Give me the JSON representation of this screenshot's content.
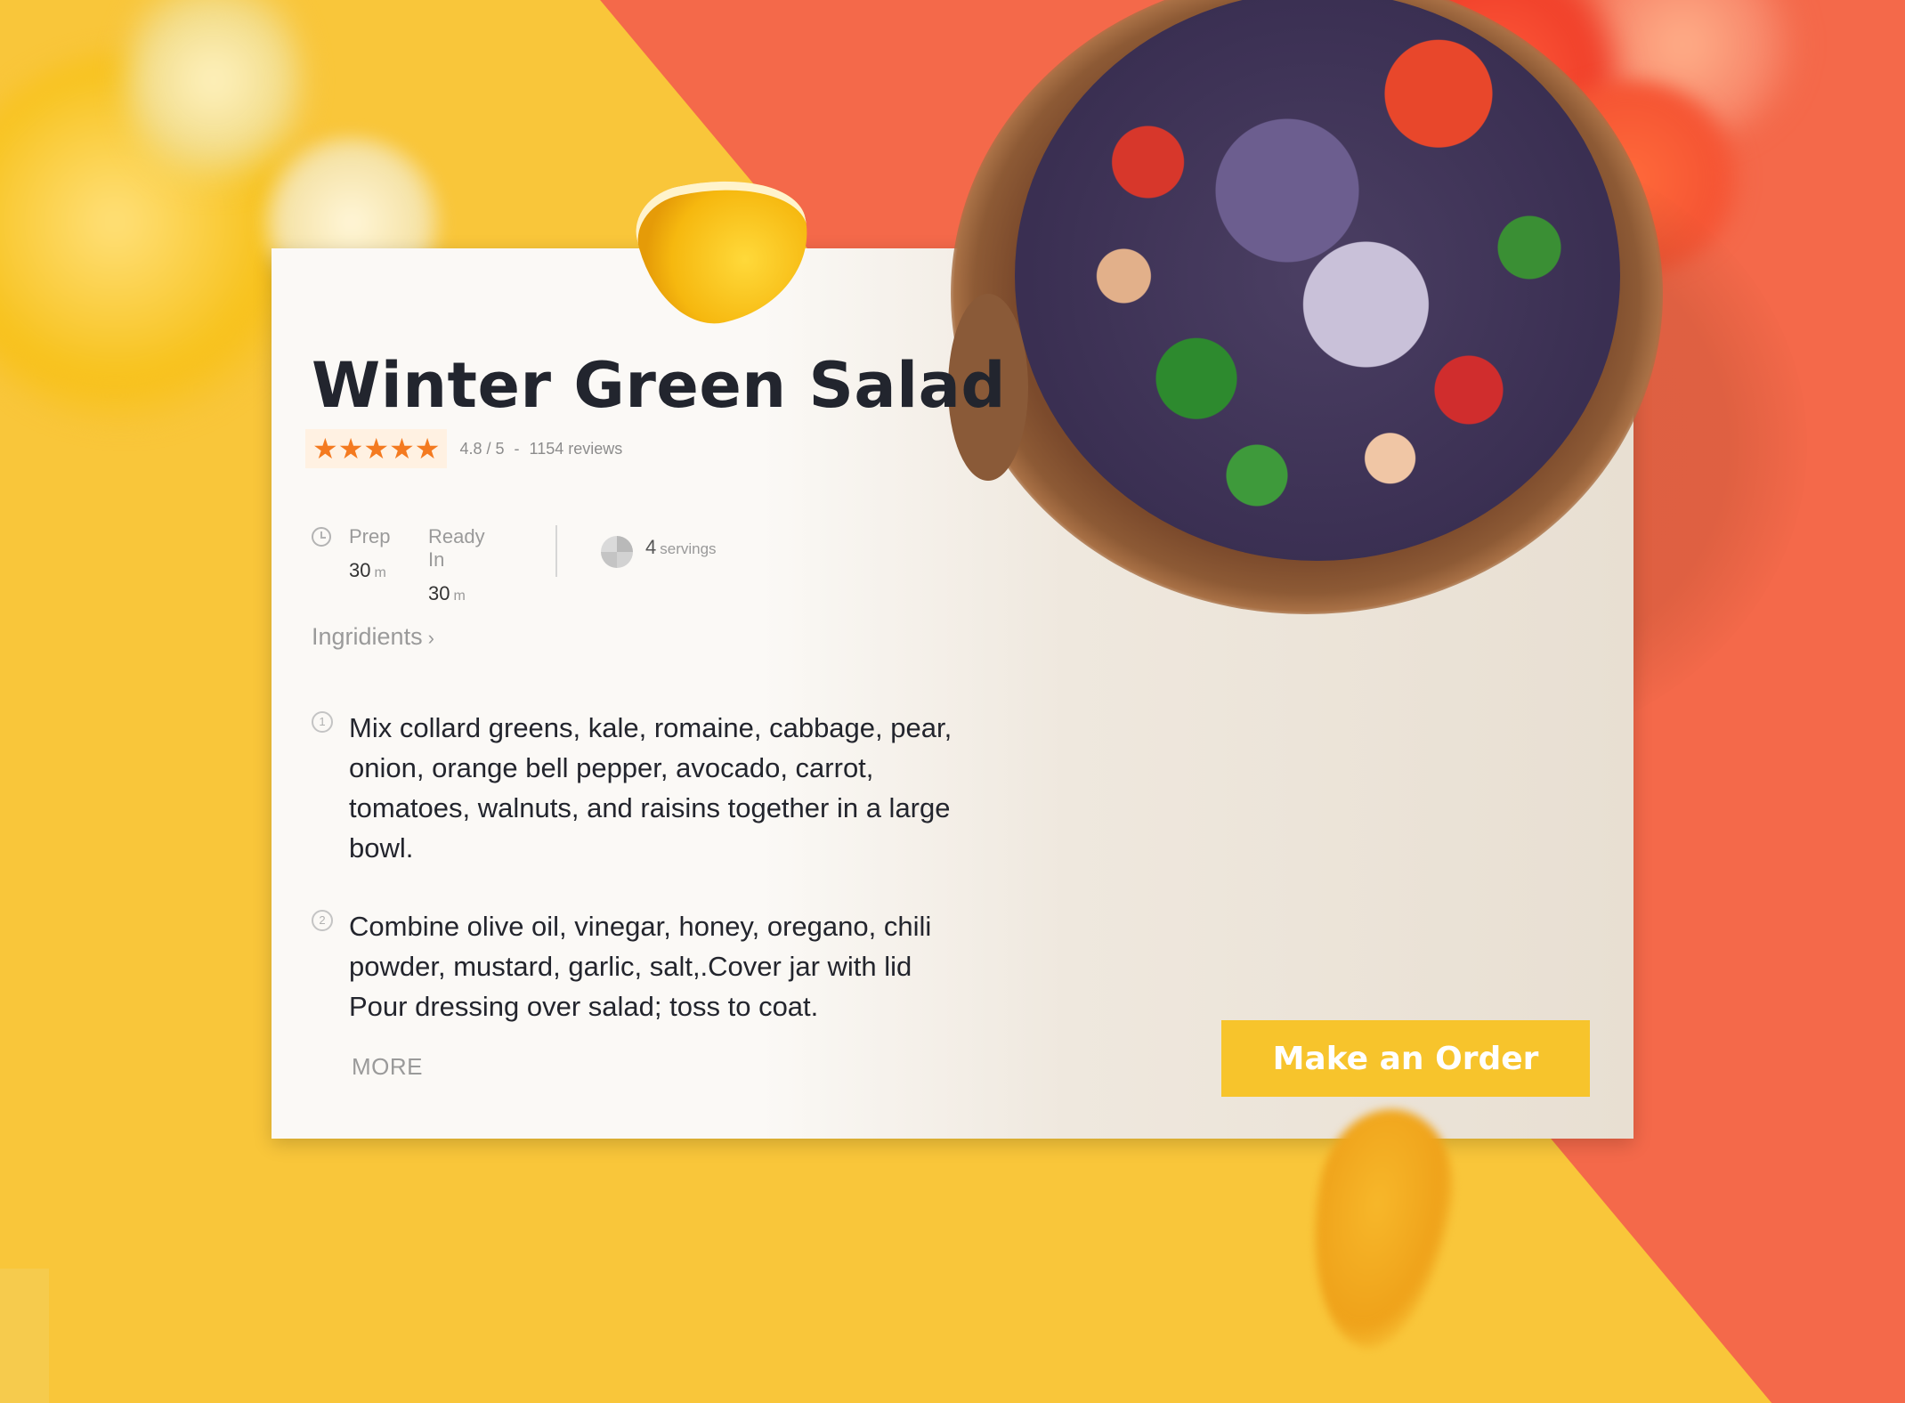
{
  "recipe": {
    "title": "Winter Green Salad",
    "rating": {
      "stars": "★★★★★",
      "score": "4.8 / 5",
      "separator": "-",
      "reviews": "1154 reviews"
    },
    "prep": {
      "label": "Prep",
      "value": "30",
      "unit": "m"
    },
    "ready": {
      "label": "Ready In",
      "value": "30",
      "unit": "m"
    },
    "servings": {
      "value": "4",
      "unit": "servings"
    },
    "ingredients_link": "Ingridients",
    "ingredients_chevron": "›",
    "steps": [
      {
        "num": "1",
        "text": "Mix collard greens, kale, romaine, cabbage, pear, onion, orange bell pepper, avocado, carrot, tomatoes, walnuts, and raisins together in a large bowl."
      },
      {
        "num": "2",
        "text": "Combine olive oil, vinegar, honey, oregano, chili powder, mustard, garlic, salt,.Cover jar with lid Pour dressing over salad; toss to coat."
      }
    ],
    "more_label": "MORE",
    "order_button": "Make an Order"
  },
  "colors": {
    "yellow_bg": "#f9c63a",
    "orange_bg": "#f4694a",
    "star": "#f47a20",
    "button": "#f7c42c"
  }
}
